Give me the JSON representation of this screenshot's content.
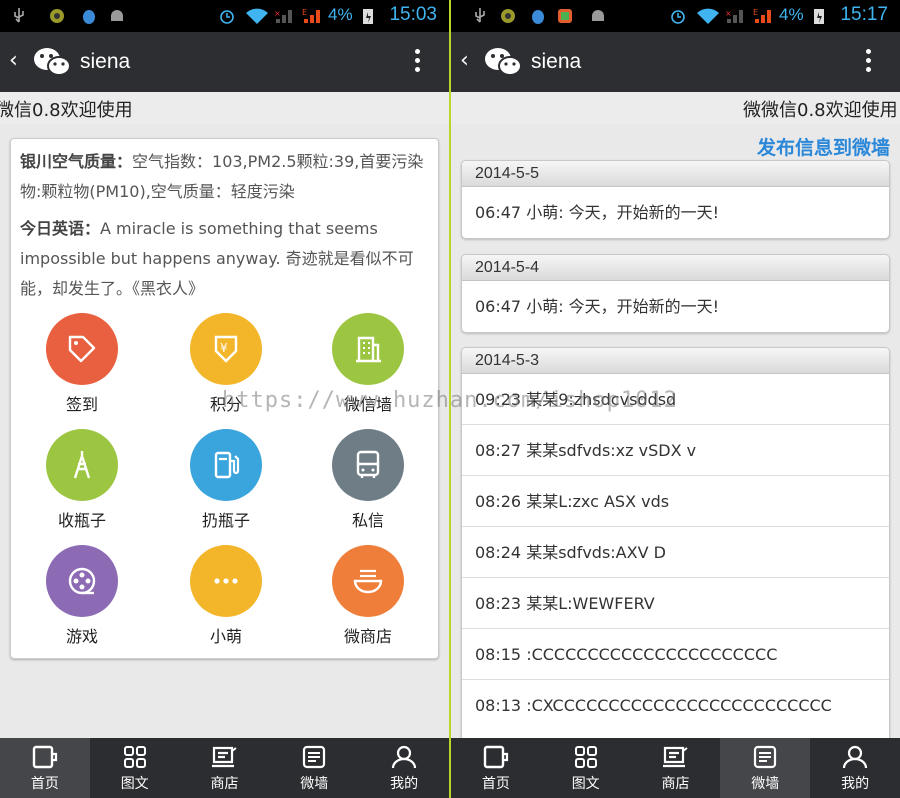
{
  "left": {
    "status": {
      "battery_pct": "4%",
      "time": "15:03"
    },
    "title": "siena",
    "marquee": "微信0.8欢迎使用",
    "weather_label": "银川空气质量：",
    "weather_text": "空气指数：103,PM2.5颗粒:39,首要污染物:颗粒物(PM10),空气质量：轻度污染",
    "english_label": "今日英语：",
    "english_text": "A miracle is something that seems impossible but happens anyway. 奇迹就是看似不可能，却发生了。《黑衣人》",
    "grid": [
      {
        "label": "签到",
        "icon": "tag-icon",
        "color": "#e8603f"
      },
      {
        "label": "积分",
        "icon": "points-icon",
        "color": "#f3b62b"
      },
      {
        "label": "微信墙",
        "icon": "building-icon",
        "color": "#9cc542"
      },
      {
        "label": "收瓶子",
        "icon": "tower-icon",
        "color": "#9cc542"
      },
      {
        "label": "扔瓶子",
        "icon": "fuel-icon",
        "color": "#3aa4dd"
      },
      {
        "label": "私信",
        "icon": "bus-icon",
        "color": "#6f7d87"
      },
      {
        "label": "游戏",
        "icon": "film-reel-icon",
        "color": "#8d6bb4"
      },
      {
        "label": "小萌",
        "icon": "dots-icon",
        "color": "#f3b62b"
      },
      {
        "label": "微商店",
        "icon": "bowl-icon",
        "color": "#ef7e3a"
      }
    ],
    "tabs": [
      {
        "label": "首页",
        "icon": "home-icon",
        "active": true
      },
      {
        "label": "图文",
        "icon": "grid-icon",
        "active": false
      },
      {
        "label": "商店",
        "icon": "store-icon",
        "active": false
      },
      {
        "label": "微墙",
        "icon": "wall-icon",
        "active": false
      },
      {
        "label": "我的",
        "icon": "user-icon",
        "active": false
      }
    ]
  },
  "right": {
    "status": {
      "battery_pct": "4%",
      "time": "15:17"
    },
    "title": "siena",
    "marquee": "微微信0.8欢迎使用",
    "post_link": "发布信息到微墙",
    "groups": [
      {
        "date": "2014-5-5",
        "rows": [
          "06:47 小萌: 今天，开始新的一天!"
        ]
      },
      {
        "date": "2014-5-4",
        "rows": [
          "06:47 小萌: 今天，开始新的一天!"
        ]
      },
      {
        "date": "2014-5-3",
        "rows": [
          "09:23 某某9:zhsdcvsddsd",
          "08:27 某某sdfvds:xz vSDX v",
          "08:26 某某L:zxc ASX vds",
          "08:24 某某sdfvds:AXV D",
          "08:23 某某L:WEWFERV",
          "08:15 :CCCCCCCCCCCCCCCCCCCCCC",
          "08:13 :CXCCCCCCCCCCCCCCCCCCCCCCCCC"
        ]
      }
    ],
    "tabs": [
      {
        "label": "首页",
        "icon": "home-icon",
        "active": false
      },
      {
        "label": "图文",
        "icon": "grid-icon",
        "active": false
      },
      {
        "label": "商店",
        "icon": "store-icon",
        "active": false
      },
      {
        "label": "微墙",
        "icon": "wall-icon",
        "active": true
      },
      {
        "label": "我的",
        "icon": "user-icon",
        "active": false
      }
    ]
  },
  "watermark": "https://www.huzhan.com/ishop1012"
}
